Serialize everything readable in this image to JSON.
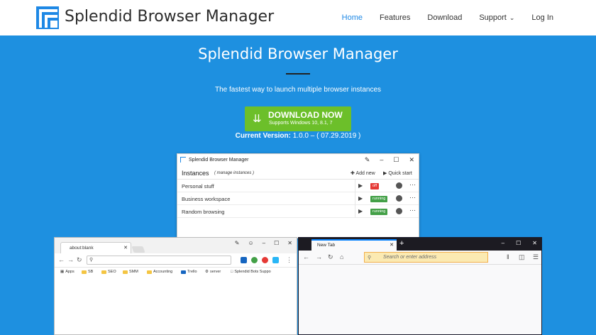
{
  "nav": {
    "brand": "Splendid Browser Manager",
    "items": [
      {
        "label": "Home"
      },
      {
        "label": "Features"
      },
      {
        "label": "Download"
      },
      {
        "label": "Support"
      },
      {
        "label": "Log In"
      }
    ]
  },
  "hero": {
    "title": "Splendid Browser Manager",
    "subtitle": "The fastest way to launch multiple browser instances",
    "download_label": "DOWNLOAD NOW",
    "download_sub": "Supports Windows 10, 8.1, 7",
    "version_label": "Current Version:",
    "version_value": "1.0.0 – ( 07.29.2019 )"
  },
  "app_window": {
    "title": "Splendid Browser Manager",
    "instances_title": "Instances",
    "manage_label": "( manage instances )",
    "add_new": "Add new",
    "quick_start": "Quick start",
    "rows": [
      {
        "name": "Personal stuff",
        "status": "off"
      },
      {
        "name": "Business workspace",
        "status": "running"
      },
      {
        "name": "Random browsing",
        "status": "running"
      }
    ]
  },
  "chrome_window": {
    "tab_label": "about:blank",
    "bookmarks": [
      "Apps",
      "SB",
      "SEO",
      "SMM",
      "Accounting",
      "Trello",
      "server",
      "Splendid Bots Suppo"
    ]
  },
  "firefox_window": {
    "tab_label": "New Tab",
    "url_placeholder": "Search or enter address"
  }
}
